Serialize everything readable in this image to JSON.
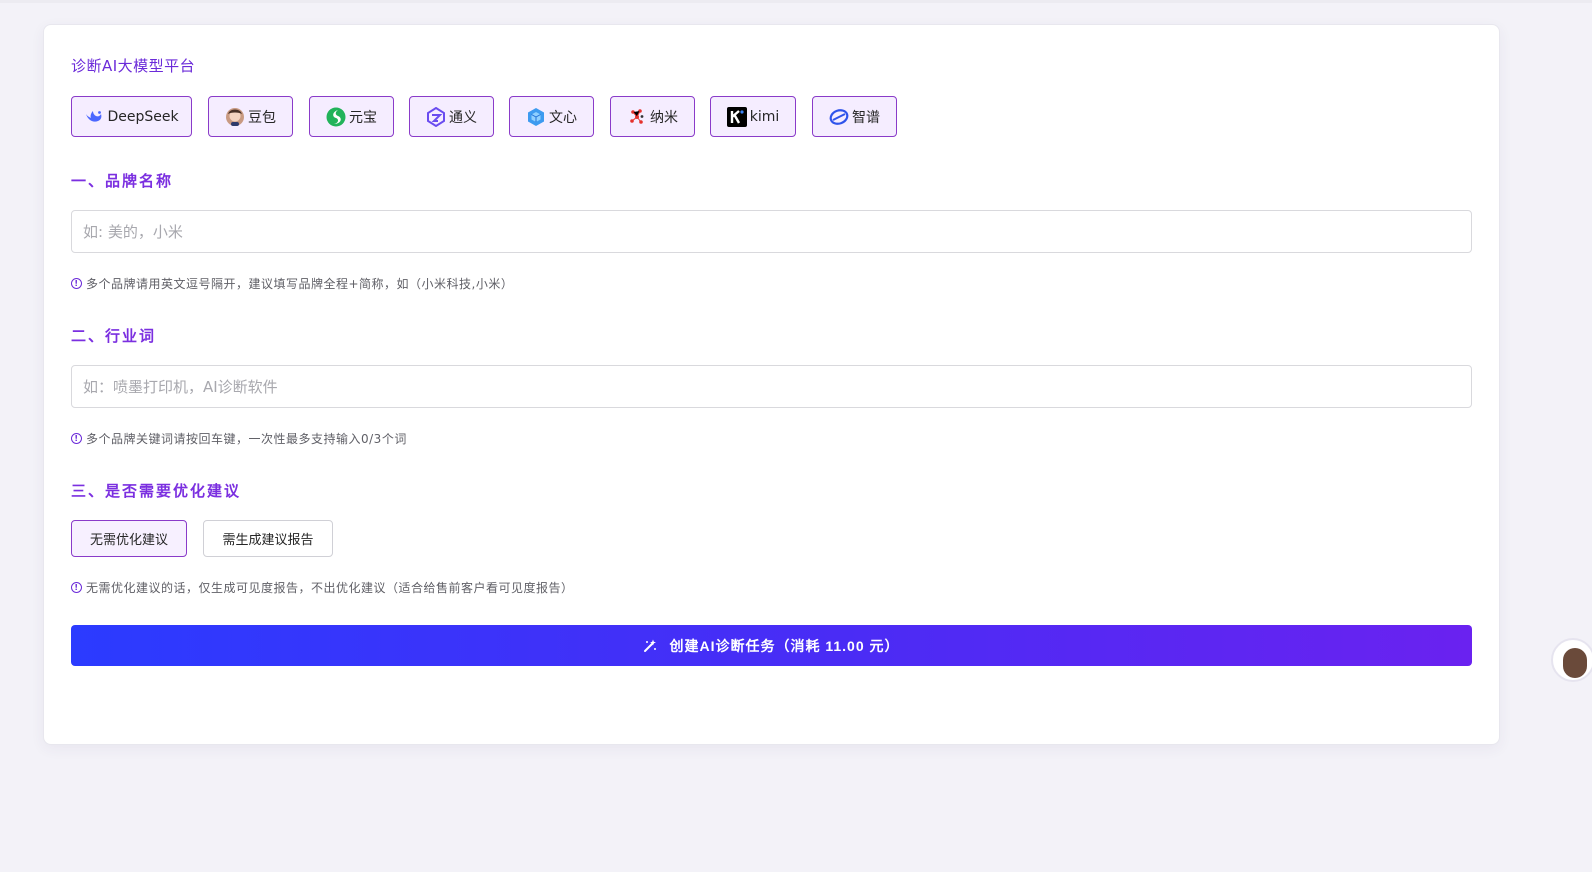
{
  "header": {
    "title": "诊断AI大模型平台"
  },
  "platforms": [
    {
      "label": "DeepSeek",
      "icon": "deepseek-icon"
    },
    {
      "label": "豆包",
      "icon": "doubao-icon"
    },
    {
      "label": "元宝",
      "icon": "yuanbao-icon"
    },
    {
      "label": "通义",
      "icon": "tongyi-icon"
    },
    {
      "label": "文心",
      "icon": "wenxin-icon"
    },
    {
      "label": "纳米",
      "icon": "nami-icon"
    },
    {
      "label": "kimi",
      "icon": "kimi-icon"
    },
    {
      "label": "智谱",
      "icon": "zhipu-icon"
    }
  ],
  "section1": {
    "title": "一、品牌名称",
    "placeholder": "如: 美的，小米",
    "value": "",
    "hint": "多个品牌请用英文逗号隔开，建议填写品牌全程+简称，如（小米科技,小米）"
  },
  "section2": {
    "title": "二、行业词",
    "placeholder": "如：喷墨打印机，AI诊断软件",
    "value": "",
    "hint": "多个品牌关键词请按回车键，一次性最多支持输入0/3个词"
  },
  "section3": {
    "title": "三、是否需要优化建议",
    "options": [
      {
        "label": "无需优化建议",
        "selected": true
      },
      {
        "label": "需生成建议报告",
        "selected": false
      }
    ],
    "hint": "无需优化建议的话，仅生成可见度报告，不出优化建议（适合给售前客户看可见度报告）"
  },
  "submit": {
    "label": "创建AI诊断任务（消耗  11.00 元）"
  },
  "colors": {
    "accent": "#7b2fe0",
    "chip_border": "#8a3bc9",
    "chip_bg": "#f5edff",
    "button_start": "#2b3bff",
    "button_end": "#6a22f0",
    "page_bg": "#f3f2f8"
  }
}
